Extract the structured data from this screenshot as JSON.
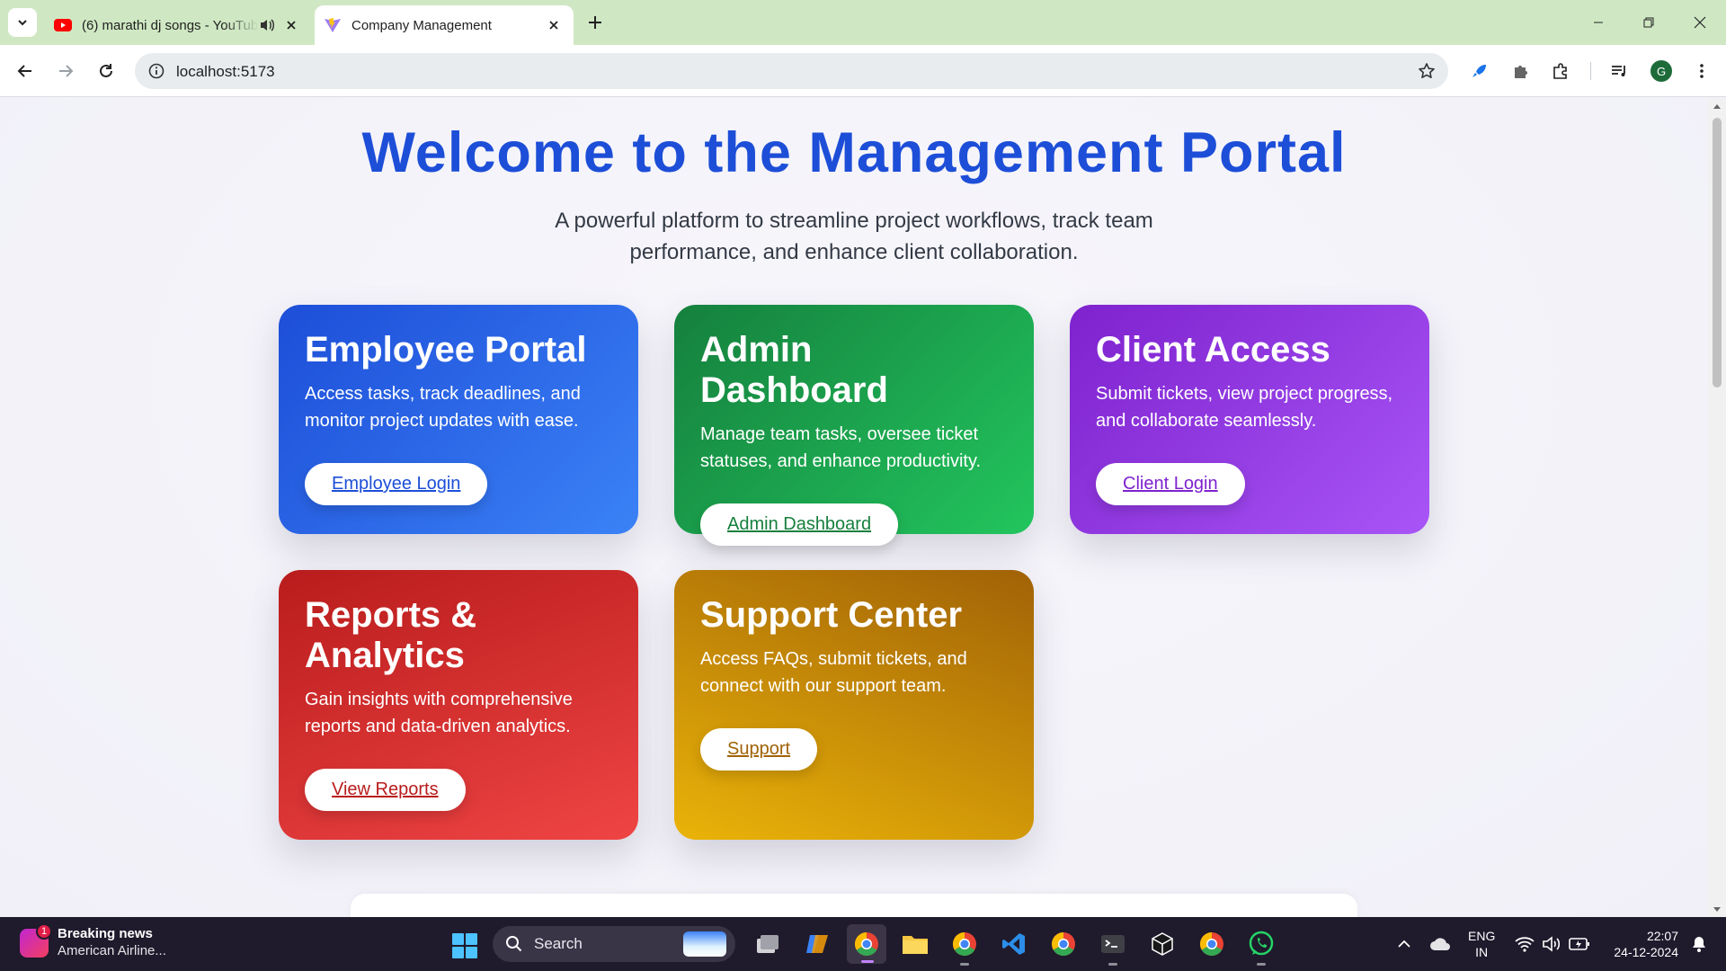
{
  "browser": {
    "tabs": [
      {
        "title": "(6) marathi dj songs - YouTube",
        "active": false,
        "audio": true
      },
      {
        "title": "Company Management",
        "active": true,
        "audio": false
      }
    ],
    "url": "localhost:5173",
    "profile_initial": "G"
  },
  "page": {
    "title": "Welcome to the Management Portal",
    "subtitle": "A powerful platform to streamline project workflows, track team performance, and enhance client collaboration.",
    "cards": [
      {
        "title": "Employee Portal",
        "description": "Access tasks, track deadlines, and monitor project updates with ease.",
        "button": "Employee Login",
        "color": "#1d4ed8"
      },
      {
        "title": "Admin Dashboard",
        "description": "Manage team tasks, oversee ticket statuses, and enhance productivity.",
        "button": "Admin Dashboard",
        "color": "#15803d"
      },
      {
        "title": "Client Access",
        "description": "Submit tickets, view project progress, and collaborate seamlessly.",
        "button": "Client Login",
        "color": "#7e22ce"
      },
      {
        "title": "Reports & Analytics",
        "description": "Gain insights with comprehensive reports and data-driven analytics.",
        "button": "View Reports",
        "color": "#b91c1c"
      },
      {
        "title": "Support Center",
        "description": "Access FAQs, submit tickets, and connect with our support team.",
        "button": "Support",
        "color": "#a16207"
      }
    ]
  },
  "taskbar": {
    "news_badge": "1",
    "news_title": "Breaking news",
    "news_subtitle": "American Airline...",
    "search_label": "Search",
    "lang_line1": "ENG",
    "lang_line2": "IN",
    "time": "22:07",
    "date": "24-12-2024"
  }
}
